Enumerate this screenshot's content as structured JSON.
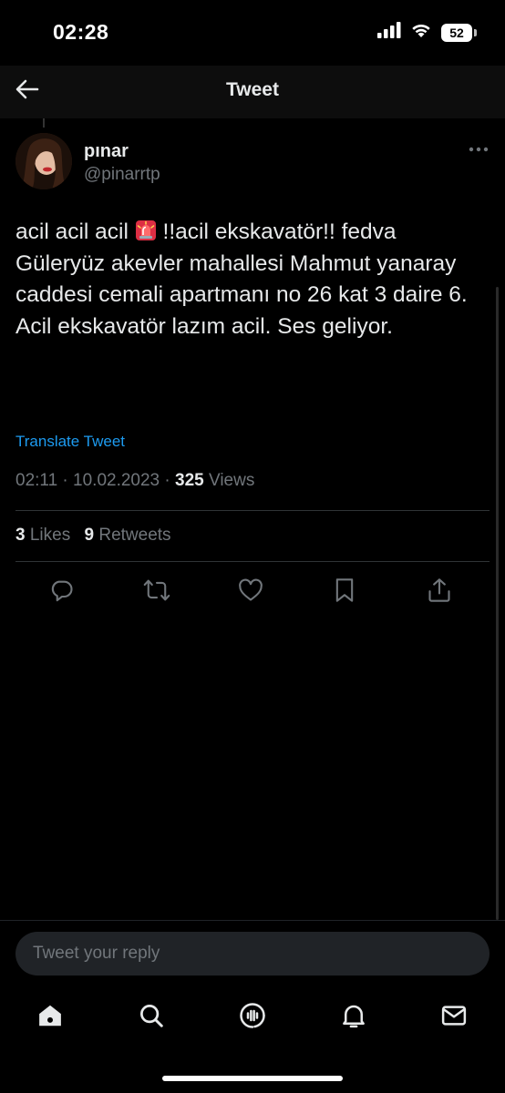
{
  "status_bar": {
    "time": "02:28",
    "battery": "52"
  },
  "header": {
    "title": "Tweet"
  },
  "tweet": {
    "display_name": "pınar",
    "handle": "@pinarrtp",
    "text_before_emoji": "acil acil acil ",
    "emoji": "siren-emoji",
    "text_after_emoji": " !!acil ekskavatör!! fedva Güleryüz akevler mahallesi Mahmut yanaray caddesi cemali apartmanı no 26 kat 3 daire 6. Acil ekskavatör lazım acil. Ses geliyor.",
    "translate_label": "Translate Tweet",
    "time": "02:11",
    "date": "10.02.2023",
    "views_count": "325",
    "views_label": "Views",
    "likes_count": "3",
    "likes_label": "Likes",
    "retweets_count": "9",
    "retweets_label": "Retweets"
  },
  "actions": [
    "reply-icon",
    "retweet-icon",
    "like-icon",
    "bookmark-icon",
    "share-icon"
  ],
  "reply": {
    "placeholder": "Tweet your reply"
  },
  "tabbar": [
    "home-icon",
    "search-icon",
    "spaces-icon",
    "notifications-icon",
    "messages-icon"
  ],
  "colors": {
    "background": "#000000",
    "text": "#e7e9ea",
    "secondary_text": "#71767b",
    "link": "#1d9bf0",
    "divider": "#2f3336"
  }
}
